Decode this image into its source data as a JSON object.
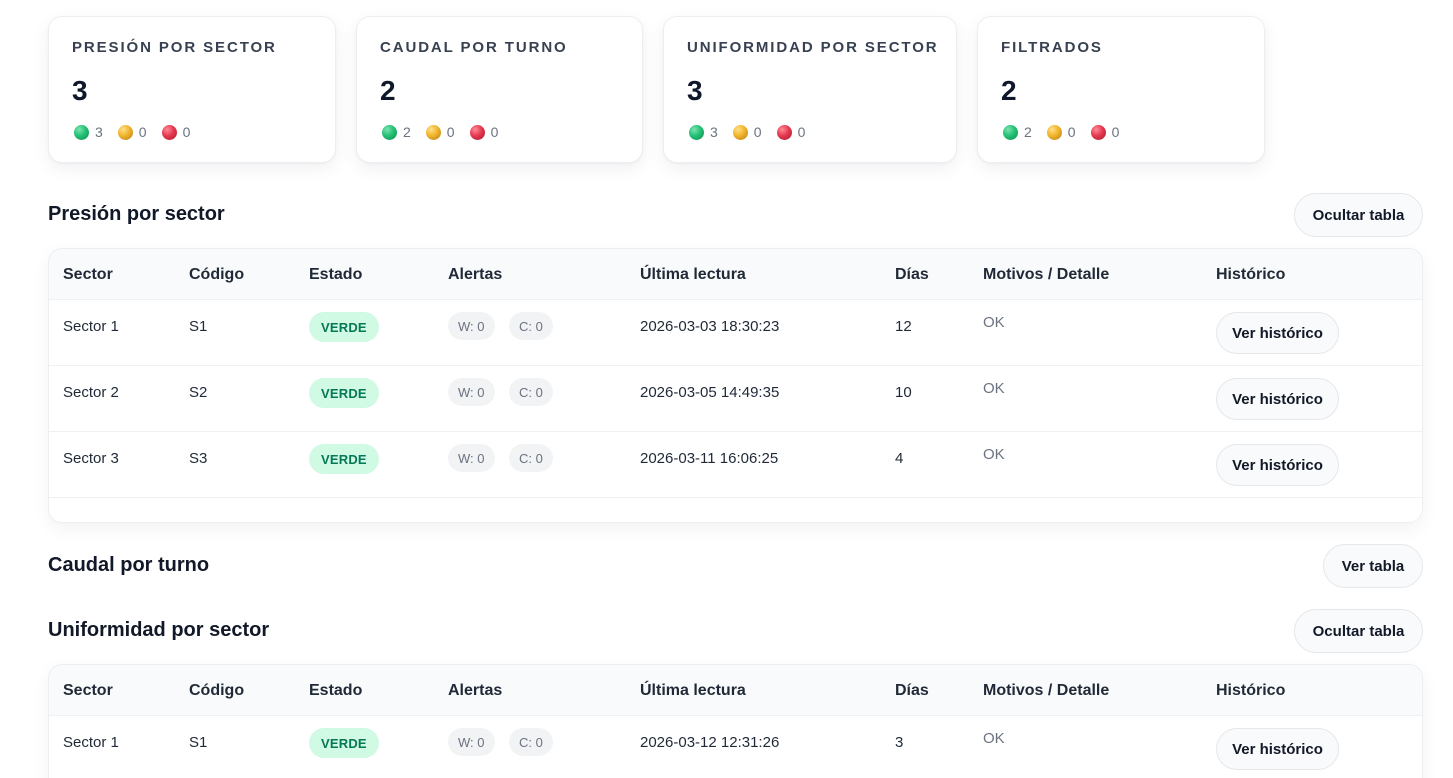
{
  "cards": [
    {
      "title": "PRESIÓN POR SECTOR",
      "value": "3",
      "green": "3",
      "yellow": "0",
      "red": "0"
    },
    {
      "title": "CAUDAL POR TURNO",
      "value": "2",
      "green": "2",
      "yellow": "0",
      "red": "0"
    },
    {
      "title": "UNIFORMIDAD POR SECTOR",
      "value": "3",
      "green": "3",
      "yellow": "0",
      "red": "0"
    },
    {
      "title": "FILTRADOS",
      "value": "2",
      "green": "2",
      "yellow": "0",
      "red": "0"
    }
  ],
  "columns": {
    "sector": "Sector",
    "codigo": "Código",
    "estado": "Estado",
    "alertas": "Alertas",
    "ultima": "Última lectura",
    "dias": "Días",
    "motivos": "Motivos / Detalle",
    "historico": "Histórico"
  },
  "presion": {
    "title": "Presión por sector",
    "toggle_label": "Ocultar tabla",
    "rows": [
      {
        "sector": "Sector 1",
        "codigo": "S1",
        "estado": "VERDE",
        "w": "W: 0",
        "c": "C: 0",
        "ultima": "2026-03-03 18:30:23",
        "dias": "12",
        "motivos": "OK",
        "btn": "Ver histórico"
      },
      {
        "sector": "Sector 2",
        "codigo": "S2",
        "estado": "VERDE",
        "w": "W: 0",
        "c": "C: 0",
        "ultima": "2026-03-05 14:49:35",
        "dias": "10",
        "motivos": "OK",
        "btn": "Ver histórico"
      },
      {
        "sector": "Sector 3",
        "codigo": "S3",
        "estado": "VERDE",
        "w": "W: 0",
        "c": "C: 0",
        "ultima": "2026-03-11 16:06:25",
        "dias": "4",
        "motivos": "OK",
        "btn": "Ver histórico"
      }
    ]
  },
  "caudal": {
    "title": "Caudal por turno",
    "toggle_label": "Ver tabla"
  },
  "uniformidad": {
    "title": "Uniformidad por sector",
    "toggle_label": "Ocultar tabla",
    "rows": [
      {
        "sector": "Sector 1",
        "codigo": "S1",
        "estado": "VERDE",
        "w": "W: 0",
        "c": "C: 0",
        "ultima": "2026-03-12 12:31:26",
        "dias": "3",
        "motivos": "OK",
        "btn": "Ver histórico"
      }
    ]
  },
  "colors": {
    "badge_green_bg": "#d1fae5",
    "badge_green_text": "#047857",
    "status_green": "#22c174",
    "status_yellow": "#f0b429",
    "status_red": "#e53950"
  }
}
